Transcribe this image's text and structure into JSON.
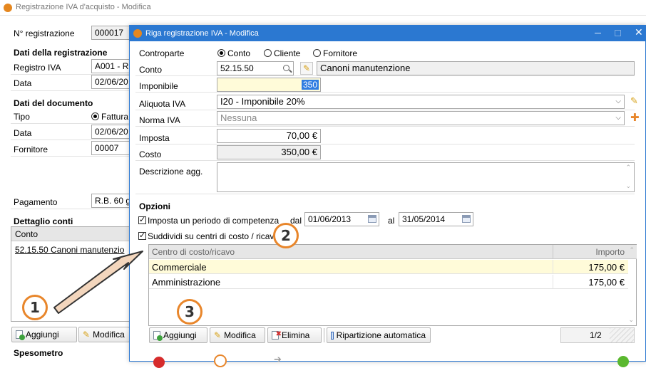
{
  "main_window": {
    "title": "Registrazione IVA d'acquisto - Modifica",
    "reg_label": "N° registrazione",
    "reg_value": "000017",
    "section_reg": "Dati della registrazione",
    "registro_label": "Registro IVA",
    "registro_value": "A001 - R",
    "data_label": "Data",
    "data_value": "02/06/20",
    "section_doc": "Dati del documento",
    "tipo_label": "Tipo",
    "tipo_option": "Fattura",
    "data2_label": "Data",
    "data2_value": "02/06/20",
    "fornitore_label": "Fornitore",
    "fornitore_value": "00007",
    "pagamento_label": "Pagamento",
    "pagamento_value": "R.B. 60 g",
    "section_dettaglio": "Dettaglio conti",
    "conti_header": "Conto",
    "conti_row": "52.15.50 Canoni manutenzio",
    "add_button": "Aggiungi",
    "edit_button": "Modifica",
    "section_spesometro": "Spesometro"
  },
  "dialog": {
    "title": "Riga registrazione IVA - Modifica",
    "controparte_label": "Controparte",
    "controparte_options": [
      "Conto",
      "Cliente",
      "Fornitore"
    ],
    "conto_label": "Conto",
    "conto_value": "52.15.50",
    "conto_desc": "Canoni manutenzione",
    "imponibile_label": "Imponibile",
    "imponibile_value": "350",
    "aliquota_label": "Aliquota IVA",
    "aliquota_value": "I20 - Imponibile 20%",
    "norma_label": "Norma IVA",
    "norma_placeholder": "Nessuna",
    "imposta_label": "Imposta",
    "imposta_value": "70,00 €",
    "costo_label": "Costo",
    "costo_value": "350,00 €",
    "descrizione_label": "Descrizione agg.",
    "opzioni_label": "Opzioni",
    "periodo_check": "Imposta un periodo di competenza",
    "dal_label": "dal",
    "dal_value": "01/06/2013",
    "al_label": "al",
    "al_value": "31/05/2014",
    "suddividi_check": "Suddividi su centri di costo / ricavo",
    "table": {
      "col1": "Centro di costo/ricavo",
      "col2": "Importo",
      "rows": [
        {
          "name": "Commerciale",
          "amount": "175,00 €"
        },
        {
          "name": "Amministrazione",
          "amount": "175,00 €"
        }
      ]
    },
    "btn_add": "Aggiungi",
    "btn_edit": "Modifica",
    "btn_delete": "Elimina",
    "btn_auto": "Ripartizione automatica",
    "page_counter": "1/2"
  },
  "callouts": [
    "1",
    "2",
    "3"
  ],
  "colors": {
    "dialog_title_bg": "#2b78d1",
    "highlight": "#2f7de1",
    "callout_orange": "#e8862b",
    "table_header_bg": "#e6e6e6"
  }
}
